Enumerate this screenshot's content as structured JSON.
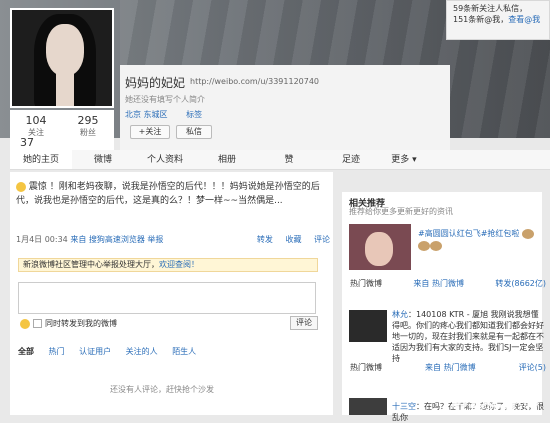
{
  "profile": {
    "name": "妈妈的妃妃",
    "url": "http://weibo.com/u/3391120740",
    "bio": "她还没有填写个人简介",
    "location": "北京 东城区",
    "tag": "标签",
    "follow_label": "+关注",
    "msg_label": "私信"
  },
  "stats": [
    {
      "num": "104",
      "label": "关注"
    },
    {
      "num": "295",
      "label": "粉丝"
    }
  ],
  "stats_extra": "37",
  "notif": {
    "line1": "59条新关注人私信，",
    "line2": "151条新@我，",
    "link": "查看@我"
  },
  "tabs": [
    "她的主页",
    "微博",
    "个人资料",
    "相册",
    "赞",
    "足迹"
  ],
  "tab_more": "更多",
  "post": {
    "text": "震惊 ！刚和老妈夜聊，说我是孙悟空的后代！！！妈妈说她是孙悟空的后代，说我也是孙悟空的后代，这是真的么？！梦一样~~当然偶是...",
    "time": "1月4日 00:34",
    "source": "来自 搜狗高速浏览器",
    "report": "举报"
  },
  "actions": [
    "转发",
    "收藏",
    "评论"
  ],
  "report_bar": {
    "text": "新浪微博社区管理中心举报处理大厅，",
    "link": "欢迎查阅！"
  },
  "comment": {
    "option": "同时转发到我的微博",
    "button": "评论"
  },
  "filters": [
    "全部",
    "热门",
    "认证用户",
    "关注的人",
    "陌生人"
  ],
  "empty_text": "还没有人评论，赶快抢个沙发",
  "side": {
    "title": "相关推荐",
    "subtitle": "推荐给你更多更新更好的资讯",
    "headline": "#高圆圆认红包飞#抢红包啦",
    "row1_left": "热门微博",
    "row1_mid": "来自 热门微博",
    "row1_right": "转发(8662亿)",
    "post_user": "林允",
    "post_text": "140108 KTR - 厦旭 我刚说我想懂得吧。你们的疼心我们都知道我们都会好好地一切的，现在封我们来就是有一起都在不适因为我们有大家的支持。我们SJ一定会坚持",
    "row2_left": "热门微博",
    "row2_mid": "来自 热门微博",
    "row2_right": "评论(5)",
    "foot_user": "十三空",
    "foot_text": "在吗？在干嘛？想你了，晚安，很乱你"
  },
  "watermark": {
    "main": "游迅网",
    "sub": "YXDOWN.COM"
  }
}
